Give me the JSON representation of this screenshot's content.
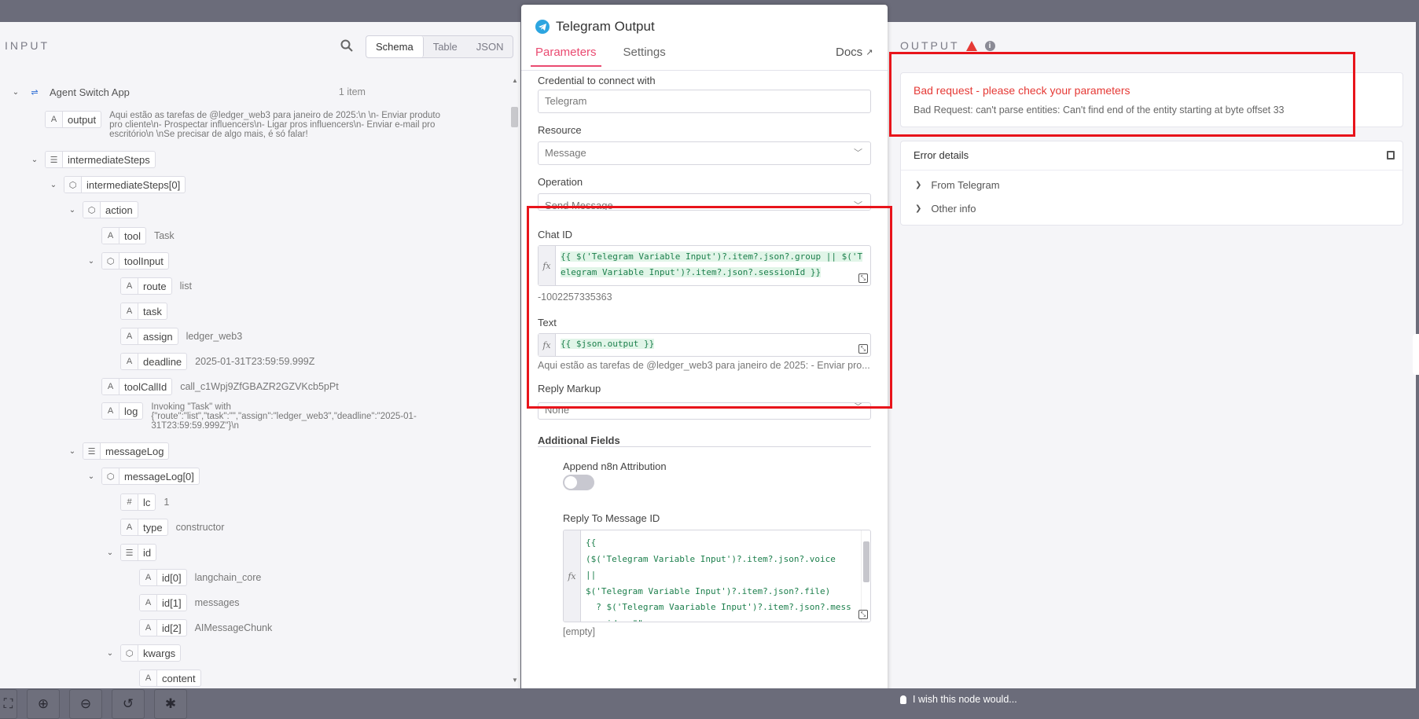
{
  "input": {
    "header": "INPUT",
    "views": [
      "Schema",
      "Table",
      "JSON"
    ],
    "active_view": "Schema",
    "item_count": "1 item",
    "tree": [
      {
        "depth": 0,
        "type": "obj-app",
        "chev": true,
        "name": "Agent Switch App",
        "value": "",
        "plain": true
      },
      {
        "depth": 1,
        "type": "A",
        "chev": false,
        "name": "output",
        "value": "Aqui estão as tarefas de @ledger_web3 para janeiro de 2025:\\n \\n- Enviar produto pro cliente\\n- Prospectar influencers\\n- Ligar pros influencers\\n- Enviar e-mail pro escritório\\n \\nSe precisar de algo mais, é só falar!",
        "wrap": true
      },
      {
        "depth": 1,
        "type": "list",
        "chev": true,
        "name": "intermediateSteps",
        "value": ""
      },
      {
        "depth": 2,
        "type": "obj",
        "chev": true,
        "name": "intermediateSteps[0]",
        "value": ""
      },
      {
        "depth": 3,
        "type": "obj",
        "chev": true,
        "name": "action",
        "value": ""
      },
      {
        "depth": 4,
        "type": "A",
        "chev": false,
        "name": "tool",
        "value": "Task"
      },
      {
        "depth": 4,
        "type": "obj",
        "chev": true,
        "name": "toolInput",
        "value": ""
      },
      {
        "depth": 5,
        "type": "A",
        "chev": false,
        "name": "route",
        "value": "list"
      },
      {
        "depth": 5,
        "type": "A",
        "chev": false,
        "name": "task",
        "value": ""
      },
      {
        "depth": 5,
        "type": "A",
        "chev": false,
        "name": "assign",
        "value": "ledger_web3"
      },
      {
        "depth": 5,
        "type": "A",
        "chev": false,
        "name": "deadline",
        "value": "2025-01-31T23:59:59.999Z"
      },
      {
        "depth": 4,
        "type": "A",
        "chev": false,
        "name": "toolCallId",
        "value": "call_c1Wpj9ZfGBAZR2GZVKcb5pPt"
      },
      {
        "depth": 4,
        "type": "A",
        "chev": false,
        "name": "log",
        "value": "Invoking \"Task\" with {\"route\":\"list\",\"task\":\"\",\"assign\":\"ledger_web3\",\"deadline\":\"2025-01-31T23:59:59.999Z\"}\\n",
        "wrap": true
      },
      {
        "depth": 3,
        "type": "list",
        "chev": true,
        "name": "messageLog",
        "value": ""
      },
      {
        "depth": 4,
        "type": "obj",
        "chev": true,
        "name": "messageLog[0]",
        "value": ""
      },
      {
        "depth": 5,
        "type": "#",
        "chev": false,
        "name": "lc",
        "value": "1"
      },
      {
        "depth": 5,
        "type": "A",
        "chev": false,
        "name": "type",
        "value": "constructor"
      },
      {
        "depth": 5,
        "type": "list",
        "chev": true,
        "name": "id",
        "value": ""
      },
      {
        "depth": 6,
        "type": "A",
        "chev": false,
        "name": "id[0]",
        "value": "langchain_core"
      },
      {
        "depth": 6,
        "type": "A",
        "chev": false,
        "name": "id[1]",
        "value": "messages"
      },
      {
        "depth": 6,
        "type": "A",
        "chev": false,
        "name": "id[2]",
        "value": "AIMessageChunk"
      },
      {
        "depth": 5,
        "type": "obj",
        "chev": true,
        "name": "kwargs",
        "value": ""
      },
      {
        "depth": 6,
        "type": "A",
        "chev": false,
        "name": "content",
        "value": ""
      }
    ]
  },
  "node": {
    "title": "Telegram Output",
    "tabs": [
      "Parameters",
      "Settings"
    ],
    "active_tab": "Parameters",
    "docs_label": "Docs",
    "credential_label": "Credential to connect with",
    "credential_value": "Telegram",
    "resource_label": "Resource",
    "resource_value": "Message",
    "operation_label": "Operation",
    "operation_value": "Send Message",
    "chat_id_label": "Chat ID",
    "chat_id_expr": "{{ $('Telegram Variable Input')?.item?.json?.group || $('Telegram Variable Input')?.item?.json?.sessionId }}",
    "chat_id_result": "-1002257335363",
    "text_label": "Text",
    "text_expr": "{{ $json.output }}",
    "text_result": "Aqui estão as tarefas de @ledger_web3 para janeiro de 2025: - Enviar pro...",
    "reply_markup_label": "Reply Markup",
    "reply_markup_value": "None",
    "additional_fields_label": "Additional Fields",
    "append_label": "Append n8n Attribution",
    "append_enabled": false,
    "reply_to_label": "Reply To Message ID",
    "reply_to_expr": "{{\n($('Telegram Variable Input')?.item?.json?.voice\n||\n$('Telegram Variable Input')?.item?.json?.file)\n  ? $('Telegram Vaariable Input')?.item?.json?.mess\nage_id : \"\"",
    "reply_to_result": "[empty]"
  },
  "output": {
    "header": "OUTPUT",
    "error_title": "Bad request - please check your parameters",
    "error_message": "Bad Request: can't parse entities: Can't find end of the entity starting at byte offset 33",
    "details_title": "Error details",
    "details_items": [
      "From Telegram",
      "Other info"
    ]
  },
  "footer": {
    "wish_label": "I wish this node would..."
  },
  "colors": {
    "accent": "#ea4b71",
    "error": "#e53935",
    "annotation": "#e8141b",
    "telegram": "#2ca5e0"
  }
}
